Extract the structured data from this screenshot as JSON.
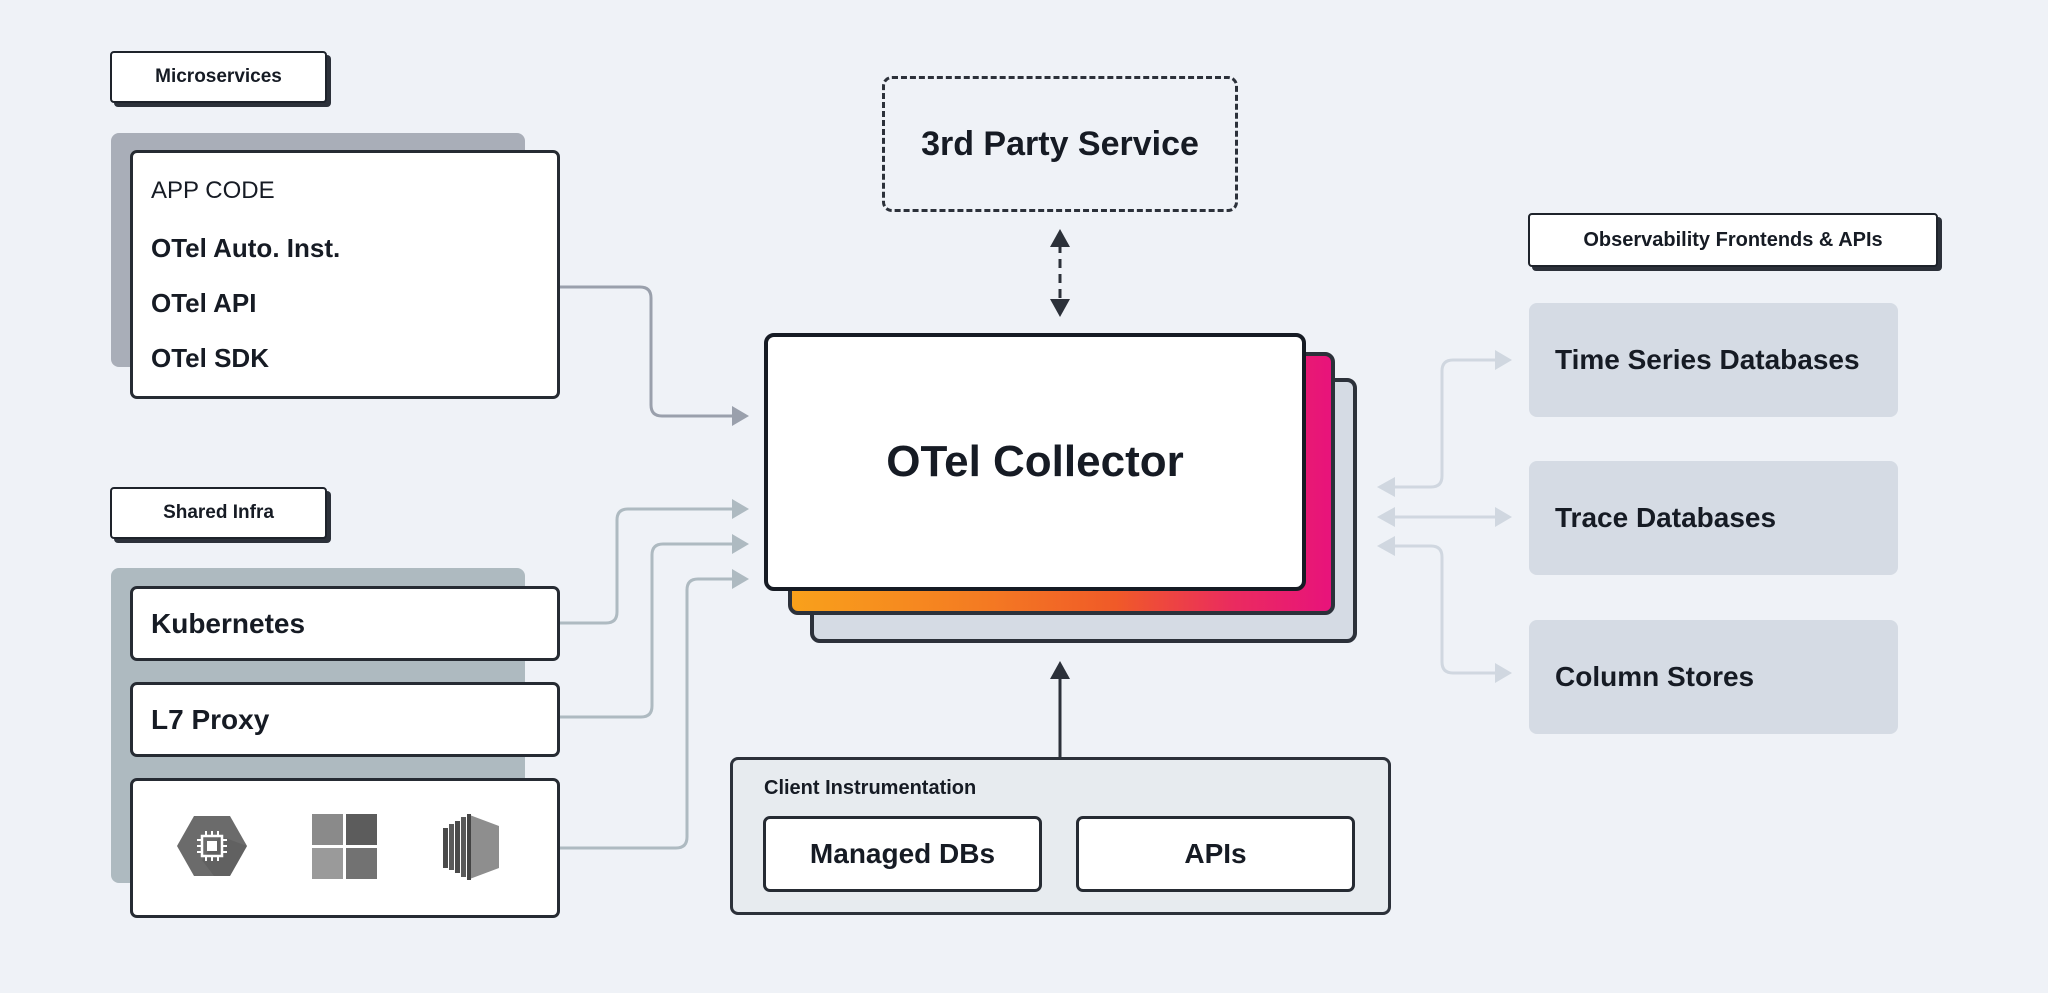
{
  "microservices": {
    "label": "Microservices",
    "items": [
      "APP CODE",
      "OTel Auto. Inst.",
      "OTel API",
      "OTel SDK"
    ]
  },
  "shared_infra": {
    "label": "Shared Infra",
    "items": [
      "Kubernetes",
      "L7 Proxy"
    ],
    "cloud_icons": [
      "gcp-compute-engine-icon",
      "azure-windows-icon",
      "aws-ec2-icon"
    ]
  },
  "third_party": {
    "label": "3rd Party Service"
  },
  "collector": {
    "label": "OTel Collector"
  },
  "client_instrumentation": {
    "label": "Client Instrumentation",
    "items": [
      "Managed DBs",
      "APIs"
    ]
  },
  "observability": {
    "label": "Observability Frontends & APIs",
    "destinations": [
      "Time Series Databases",
      "Trace Databases",
      "Column Stores"
    ]
  },
  "colors": {
    "background": "#EFF2F7",
    "border_dark": "#2C313A",
    "microservices_arrow": "#9AA0AC",
    "infra_arrow": "#AEBAC1",
    "destination_arrow": "#D0D7E0",
    "gradient_start": "#F9A11B",
    "gradient_mid": "#F05A28",
    "gradient_end": "#E8137B",
    "destination_fill": "#D5DBE4"
  }
}
